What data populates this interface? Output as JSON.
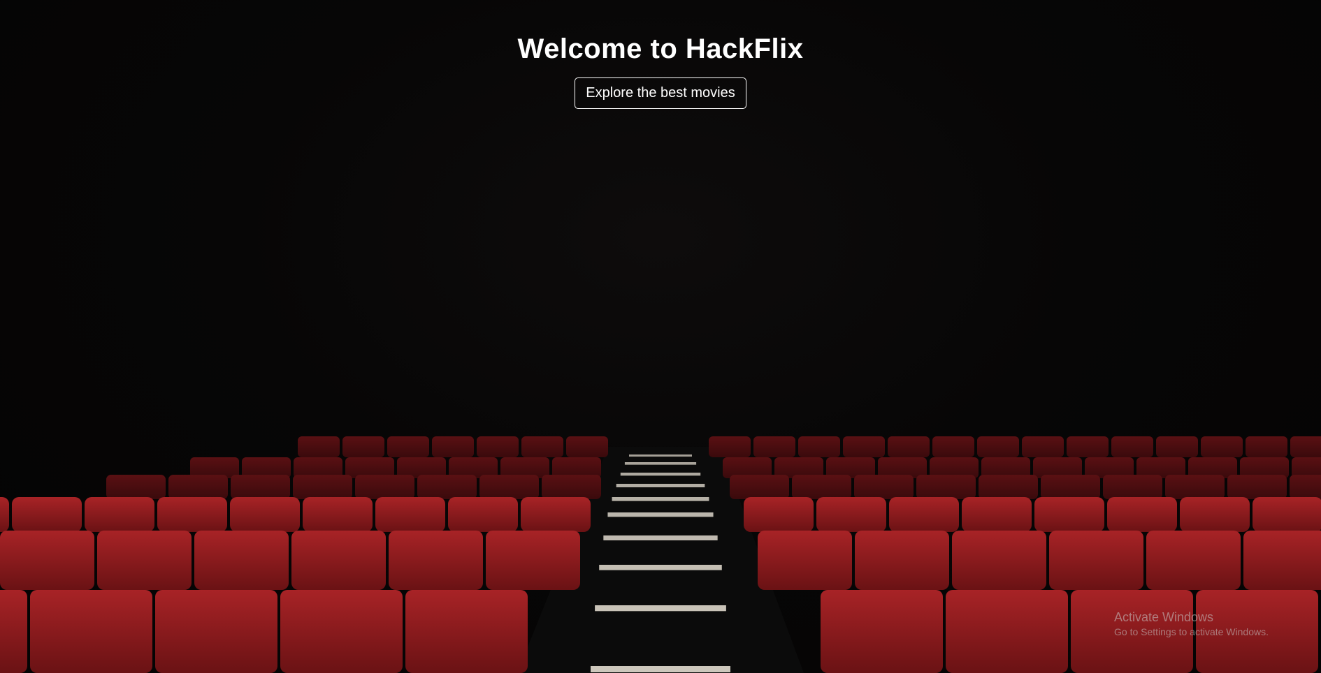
{
  "hero": {
    "title": "Welcome to HackFlix",
    "button_label": "Explore the best movies"
  },
  "watermark": {
    "title": "Activate Windows",
    "subtitle": "Go to Settings to activate Windows."
  },
  "colors": {
    "background": "#050505",
    "seat": "#8a1a1c",
    "seat_highlight": "#a82326",
    "step": "#d8d2c6",
    "text": "#ffffff"
  }
}
